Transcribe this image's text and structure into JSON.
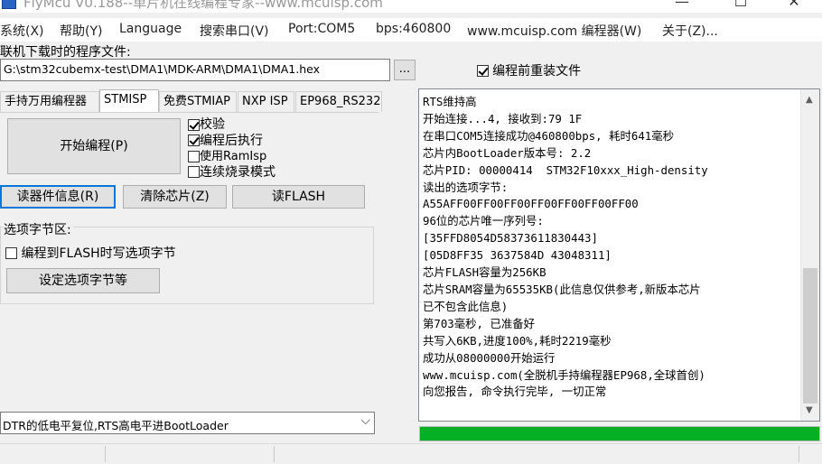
{
  "window": {
    "title": "FlyMcu V0.188--单片机在线编程专家--www.mcuisp.com",
    "minimize": "—",
    "maximize": "☐",
    "close": "✕"
  },
  "menu": [
    "系统(X)",
    "帮助(Y)",
    "Language",
    "搜索串口(V)",
    "Port:COM5",
    "bps:460800",
    "www.mcuisp.com 编程器(W)",
    "关于(Z)..."
  ],
  "program_file": {
    "label": "联机下载时的程序文件:",
    "path": "G:\\stm32cubemx-test\\DMA1\\MDK-ARM\\DMA1\\DMA1.hex",
    "browse_label": "...",
    "reload_label": "编程前重装文件",
    "reload_checked": true
  },
  "tabs": [
    "手持万用编程器",
    "STMISP",
    "免费STMIAP",
    "NXP ISP",
    "EP968_RS232"
  ],
  "active_tab": 1,
  "left": {
    "start_label": "开始编程(P)",
    "options": [
      {
        "label": "校验",
        "checked": true
      },
      {
        "label": "编程后执行",
        "checked": true
      },
      {
        "label": "使用RamIsp",
        "checked": false
      },
      {
        "label": "连续烧录模式",
        "checked": false
      }
    ],
    "read_info": "读器件信息(R)",
    "erase": "清除芯片(Z)",
    "read_flash": "读FLASH",
    "option_group_label": "选项字节区:",
    "write_option_label": "编程到FLASH时写选项字节",
    "write_option_checked": false,
    "set_option_button": "设定选项字节等"
  },
  "bottom_select": {
    "value": "DTR的低电平复位,RTS高电平进BootLoader",
    "arrow": "⌵"
  },
  "log_lines": [
    "RTS维持高",
    "开始连接...4, 接收到:79 1F",
    "在串口COM5连接成功@460800bps, 耗时641毫秒",
    "芯片内BootLoader版本号: 2.2",
    "芯片PID: 00000414  STM32F10xxx_High-density",
    "读出的选项字节:",
    "A55AFF00FF00FF00FF00FF00FF00FF00",
    "96位的芯片唯一序列号:",
    "[35FFD8054D58373611830443]",
    "[05D8FF35 3637584D 43048311]",
    "芯片FLASH容量为256KB",
    "芯片SRAM容量为65535KB(此信息仅供参考,新版本芯片",
    "已不包含此信息)",
    "第703毫秒, 已准备好",
    "共写入6KB,进度100%,耗时2219毫秒",
    "成功从08000000开始运行",
    "www.mcuisp.com(全脱机手持编程器EP968,全球首创)",
    "向您报告, 命令执行完毕, 一切正常"
  ],
  "scroll_up": "▲",
  "scroll_down": "▼",
  "progress_fraction": 1.0,
  "colors": {
    "progress": "#06b025",
    "focus": "#0078d7"
  }
}
